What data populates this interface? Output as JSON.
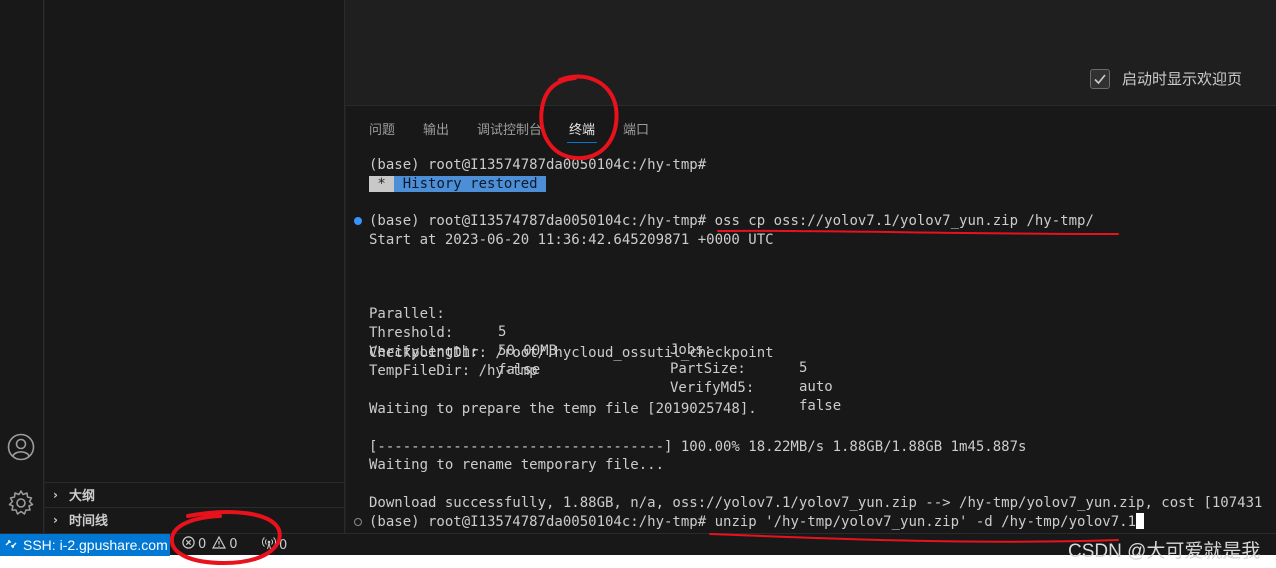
{
  "sidebar": {
    "sections": [
      {
        "label": "大纲"
      },
      {
        "label": "时间线"
      }
    ]
  },
  "welcome": {
    "checkbox_label": "启动时显示欢迎页",
    "checked": true
  },
  "panel": {
    "tabs": [
      {
        "label": "问题"
      },
      {
        "label": "输出"
      },
      {
        "label": "调试控制台"
      },
      {
        "label": "终端",
        "active": true
      },
      {
        "label": "端口"
      }
    ]
  },
  "terminal": {
    "line1": "(base) root@I13574787da0050104c:/hy-tmp#",
    "history_star": " * ",
    "history_text": " History restored ",
    "prompt": "(base) root@I13574787da0050104c:/hy-tmp#",
    "cmd1": " oss cp oss://yolov7.1/yolov7_yun.zip /hy-tmp/",
    "start": "Start at 2023-06-20 11:36:42.645209871 +0000 UTC",
    "params": [
      {
        "k1": "Parallel:",
        "v1": "5",
        "k2": "Jobs:",
        "v2": "5"
      },
      {
        "k1": "Threshold:",
        "v1": "50.00MB",
        "k2": "PartSize:",
        "v2": "auto"
      },
      {
        "k1": "VerifyLength:",
        "v1": "false",
        "k2": "VerifyMd5:",
        "v2": "false"
      }
    ],
    "checkpoint": "CheckpointDir: /root/.hycloud_ossutil_checkpoint",
    "tempdir": "TempFileDir: /hy-tmp",
    "waiting_prepare": "Waiting to prepare the temp file [2019025748].",
    "progress": "[----------------------------------] 100.00% 18.22MB/s 1.88GB/1.88GB 1m45.887s",
    "waiting_rename": "Waiting to rename temporary file...",
    "download": "Download successfully, 1.88GB, n/a, oss://yolov7.1/yolov7_yun.zip --> /hy-tmp/yolov7_yun.zip, cost [107431",
    "cmd2": " unzip '/hy-tmp/yolov7_yun.zip' -d /hy-tmp/yolov7.1"
  },
  "statusbar": {
    "remote_label": "SSH: i-2.gpushare.com",
    "errors": "0",
    "warnings": "0",
    "ports": "0"
  },
  "watermark": "CSDN @大可爱就是我",
  "colors": {
    "accent": "#0078d4",
    "annotation": "#e8121c"
  }
}
